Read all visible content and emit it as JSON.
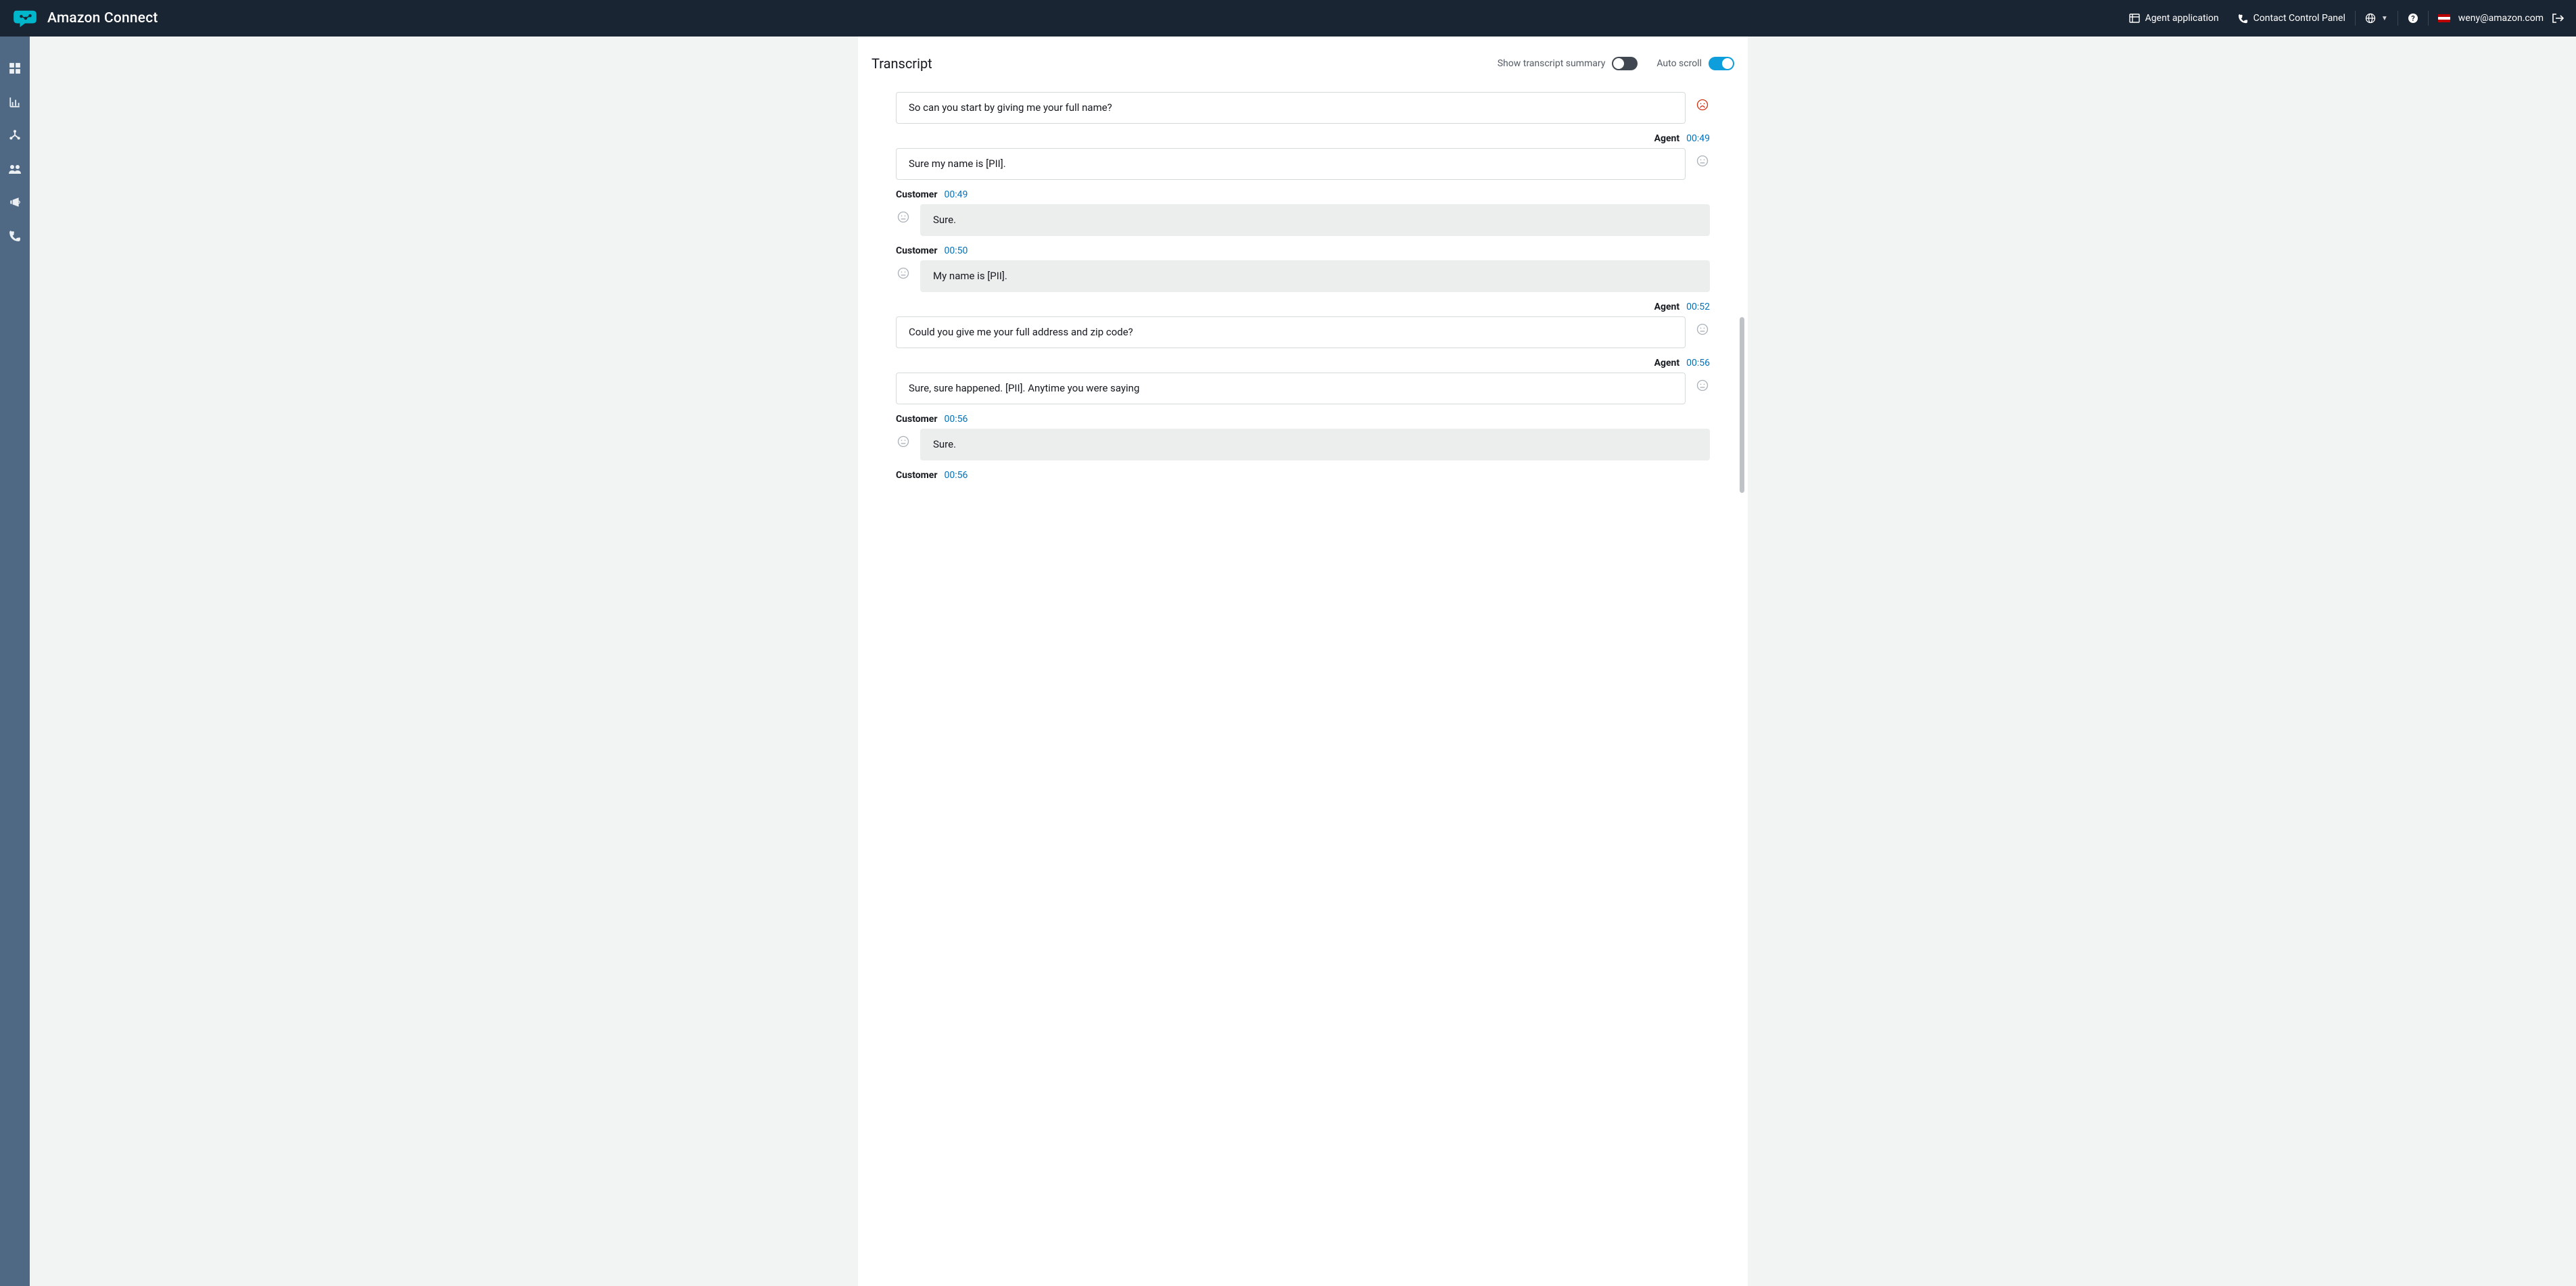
{
  "nav": {
    "brand": "Amazon Connect",
    "agent_app": "Agent application",
    "ccp": "Contact Control Panel",
    "user_email": "weny@amazon.com"
  },
  "section": {
    "title": "Transcript",
    "summary_label": "Show transcript summary",
    "autoscroll_label": "Auto scroll"
  },
  "labels": {
    "agent": "Agent",
    "customer": "Customer"
  },
  "transcript": [
    {
      "role": "agent",
      "time": "",
      "text": "So can you start by giving me your full name?",
      "sentiment": "negative",
      "show_header": false
    },
    {
      "role": "agent",
      "time": "00:49",
      "text": "Sure my name is [PII].",
      "sentiment": "neutral",
      "show_header": true
    },
    {
      "role": "customer",
      "time": "00:49",
      "text": "Sure.",
      "sentiment": "neutral",
      "show_header": true
    },
    {
      "role": "customer",
      "time": "00:50",
      "text": "My name is [PII].",
      "sentiment": "neutral",
      "show_header": true
    },
    {
      "role": "agent",
      "time": "00:52",
      "text": "Could you give me your full address and zip code?",
      "sentiment": "neutral",
      "show_header": true
    },
    {
      "role": "agent",
      "time": "00:56",
      "text": "Sure, sure happened. [PII]. Anytime you were saying",
      "sentiment": "neutral",
      "show_header": true
    },
    {
      "role": "customer",
      "time": "00:56",
      "text": "Sure.",
      "sentiment": "neutral",
      "show_header": true
    },
    {
      "role": "customer",
      "time": "00:56",
      "text": "",
      "sentiment": "",
      "show_header": true,
      "header_only": true
    }
  ]
}
